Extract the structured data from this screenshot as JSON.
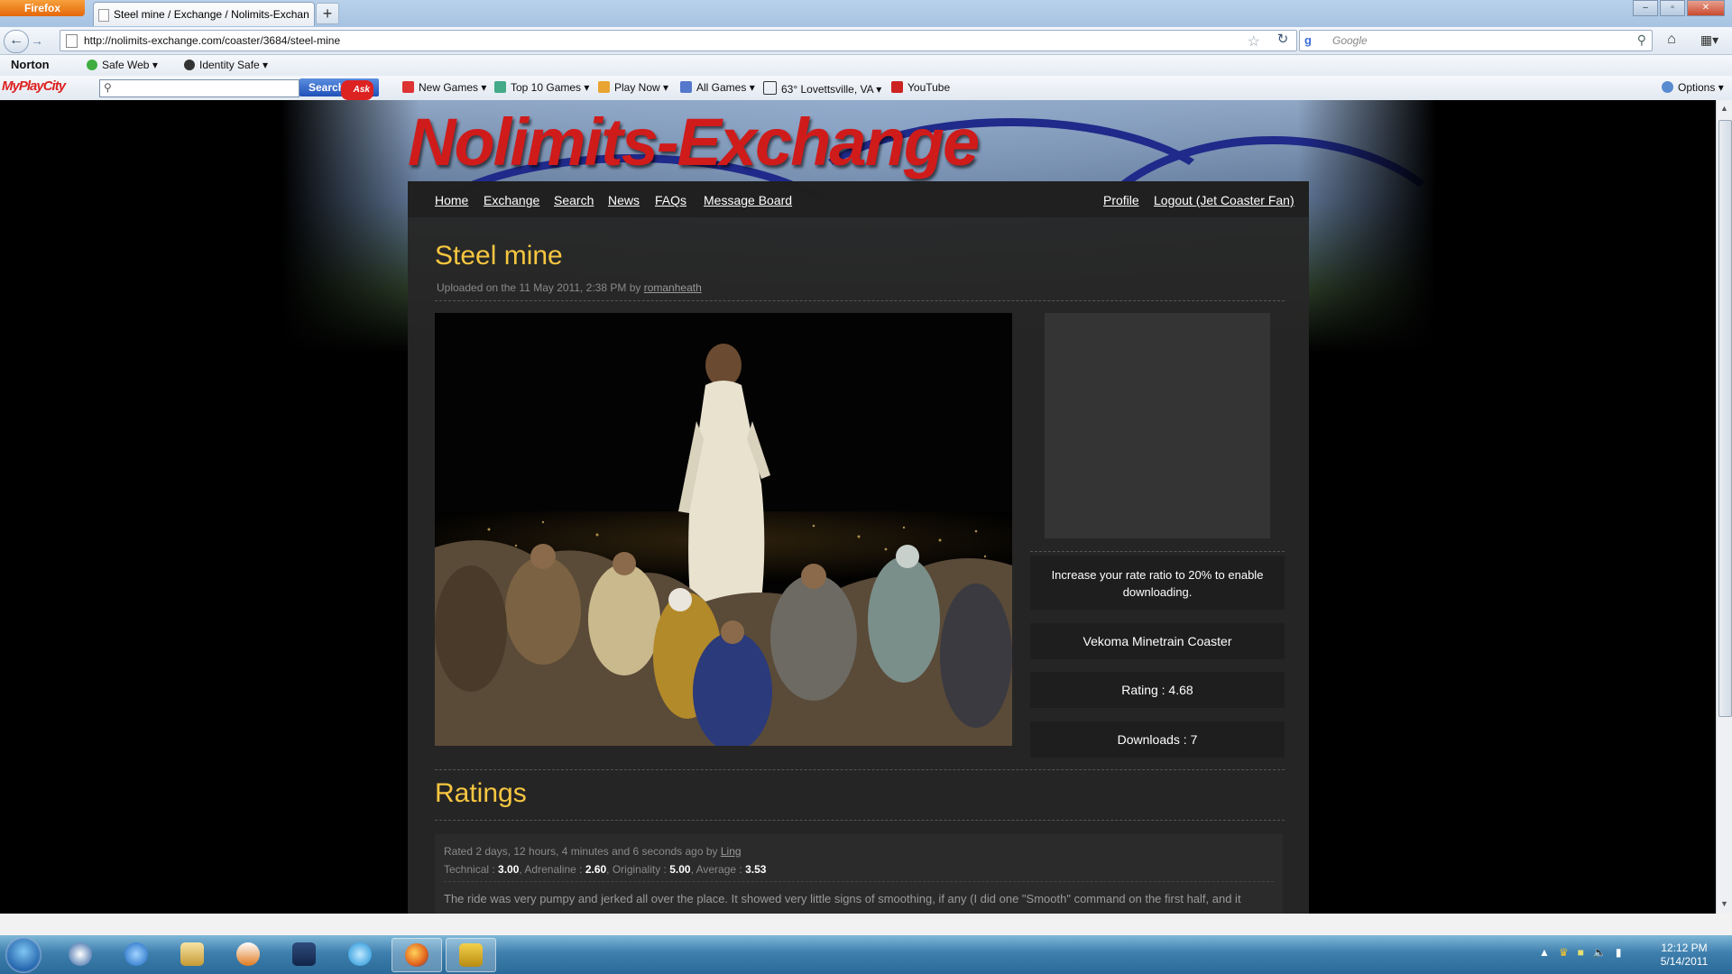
{
  "browser": {
    "menu_button": "Firefox",
    "tab_title": "Steel mine / Exchange / Nolimits-Exchan...",
    "new_tab": "+",
    "url": "http://nolimits-exchange.com/coaster/3684/steel-mine",
    "search_placeholder": "Google",
    "window_controls": [
      "–",
      "▫",
      "✕"
    ]
  },
  "norton_bar": {
    "brand": "Norton",
    "safe_web": "Safe Web",
    "identity_safe": "Identity Safe"
  },
  "ask_bar": {
    "logo": "MyPlayCity",
    "search_button": "Search",
    "ask_badge": "Ask",
    "items": [
      "New Games",
      "Top 10 Games",
      "Play Now",
      "All Games",
      "63° Lovettsville, VA",
      "YouTube"
    ],
    "options": "Options"
  },
  "site": {
    "logo": "Nolimits-Exchange",
    "nav_left": [
      "Home",
      "Exchange",
      "Search",
      "News",
      "FAQs",
      "Message Board"
    ],
    "nav_right": [
      "Profile",
      "Logout (Jet Coaster Fan)"
    ],
    "title": "Steel mine",
    "uploaded_prefix": "Uploaded on the 11 May 2011, 2:38 PM by",
    "uploader": "romanheath",
    "download_notice": "Increase your rate ratio to 20% to enable downloading.",
    "coaster_type": "Vekoma Minetrain Coaster",
    "rating": "Rating : 4.68",
    "downloads": "Downloads : 7",
    "ratings_heading": "Ratings",
    "review": {
      "meta_prefix": "Rated 2 days, 12 hours, 4 minutes and 6 seconds ago by",
      "author": "Ling",
      "technical_label": "Technical :",
      "technical": "3.00",
      "adrenaline_label": "Adrenaline :",
      "adrenaline": "2.60",
      "originality_label": "Originality :",
      "originality": "5.00",
      "average_label": "Average :",
      "average": "3.53",
      "text": "The ride was very pumpy and jerked all over the place. It showed very little signs of smoothing, if any (I did one \"Smooth\" command on the first half, and it"
    }
  },
  "taskbar": {
    "time": "12:12 PM",
    "date": "5/14/2011"
  }
}
